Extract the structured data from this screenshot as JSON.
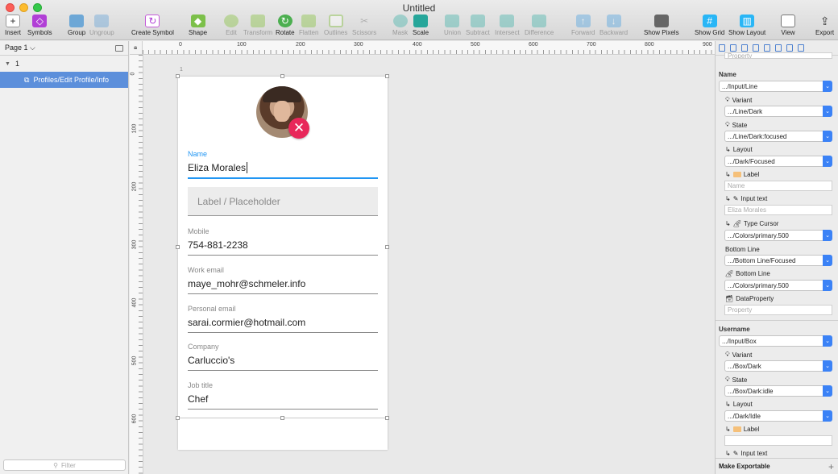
{
  "window": {
    "title": "Untitled"
  },
  "toolbar": {
    "insert": "Insert",
    "symbols": "Symbols",
    "group": "Group",
    "ungroup": "Ungroup",
    "create_symbol": "Create Symbol",
    "shape": "Shape",
    "edit": "Edit",
    "transform": "Transform",
    "rotate": "Rotate",
    "flatten": "Flatten",
    "outlines": "Outlines",
    "scissors": "Scissors",
    "mask": "Mask",
    "scale": "Scale",
    "union": "Union",
    "subtract": "Subtract",
    "intersect": "Intersect",
    "difference": "Difference",
    "forward": "Forward",
    "backward": "Backward",
    "show_pixels": "Show Pixels",
    "show_grid": "Show Grid",
    "show_layout": "Show Layout",
    "view": "View",
    "export": "Export"
  },
  "left_panel": {
    "page_selector": "Page 1",
    "page_arrow": "⌵",
    "group_arrow": "▼",
    "group": "1",
    "layer": "Profiles/Edit Profile/Info",
    "filter_placeholder": "Filter"
  },
  "rulers": {
    "top": [
      "0",
      "100",
      "200",
      "300",
      "400",
      "500",
      "600",
      "700",
      "800",
      "900"
    ],
    "left": [
      "0",
      "100",
      "200",
      "300",
      "400",
      "500",
      "600"
    ]
  },
  "artboard": {
    "number": "1",
    "name_label": "Name",
    "name_value": "Eliza Morales",
    "placeholder": "Label / Placeholder",
    "fields": [
      {
        "label": "Mobile",
        "value": "754-881-2238"
      },
      {
        "label": "Work email",
        "value": "maye_mohr@schmeler.info"
      },
      {
        "label": "Personal email",
        "value": "sarai.cormier@hotmail.com"
      },
      {
        "label": "Company",
        "value": "Carluccio's"
      },
      {
        "label": "Job title",
        "value": "Chef"
      }
    ]
  },
  "inspector": {
    "top_cut_field": "Property",
    "name_section": "Name",
    "name_symbol": ".../Input/Line",
    "variant_label": "Variant",
    "variant_value": ".../Line/Dark",
    "state_label": "State",
    "state_value": ".../Line/Dark:focused",
    "layout_label": "Layout",
    "layout_value": ".../Dark/Focused",
    "label_label": "Label",
    "label_value": "Name",
    "input_text_label": "Input text",
    "input_text_value": "Eliza Morales",
    "type_cursor_label": "Type Cursor",
    "type_cursor_value": ".../Colors/primary.500",
    "bottom_line_group": "Bottom Line",
    "bottom_line_value": ".../Bottom Line/Focused",
    "bottom_line_label": "Bottom Line",
    "bottom_line_color": ".../Colors/primary.500",
    "data_property_label": "DataProperty",
    "data_property_placeholder": "Property",
    "username_section": "Username",
    "username_symbol": ".../Input/Box",
    "u_variant_label": "Variant",
    "u_variant_value": ".../Box/Dark",
    "u_state_label": "State",
    "u_state_value": ".../Box/Dark:idle",
    "u_layout_label": "Layout",
    "u_layout_value": ".../Dark/Idle",
    "u_label_label": "Label",
    "u_input_text_label": "Input text",
    "make_exportable": "Make Exportable",
    "add_glyph": "+"
  },
  "colors": {
    "accent": "#2196f3",
    "remove": "#e8275a",
    "selection": "#5c8fdb"
  }
}
